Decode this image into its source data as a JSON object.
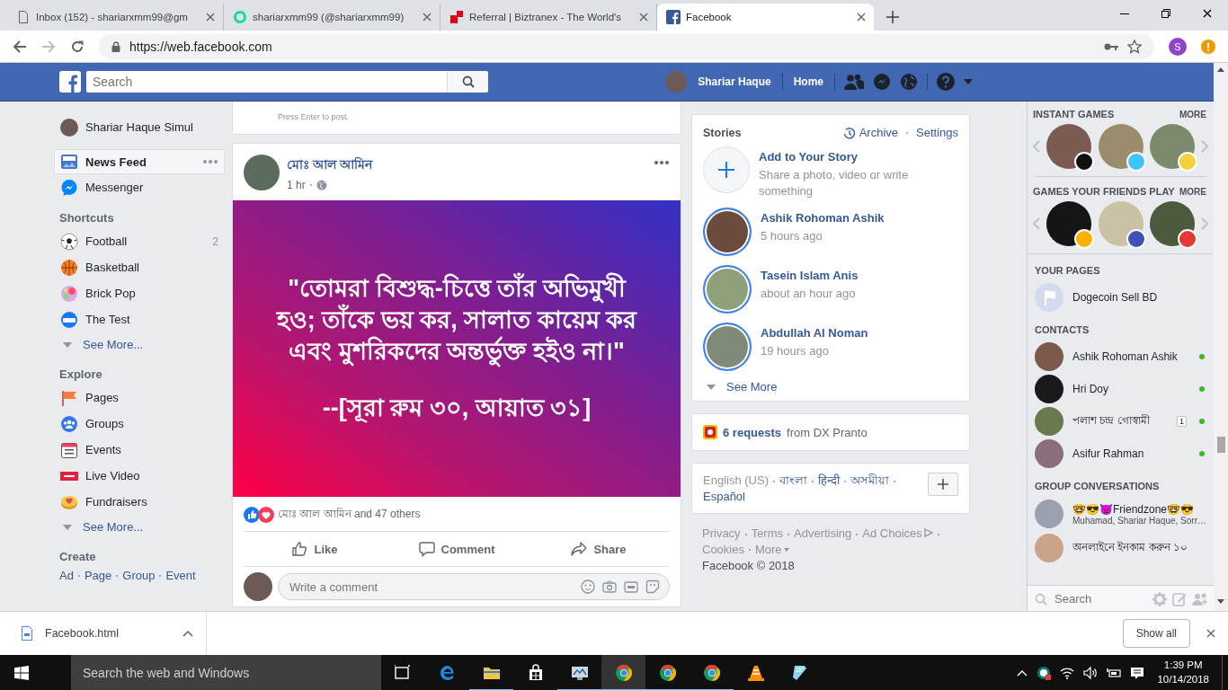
{
  "browser": {
    "tabs": [
      {
        "title": "Inbox (152) - shariarxmm99@gm",
        "selected": false
      },
      {
        "title": "shariarxmm99 (@shariarxmm99)",
        "selected": false
      },
      {
        "title": "Referral | Biztranex - The World's",
        "selected": false
      },
      {
        "title": "Facebook",
        "selected": true
      }
    ],
    "url": "https://web.facebook.com",
    "profile_initial": "S"
  },
  "topbar": {
    "search_placeholder": "Search",
    "user_name": "Shariar Haque",
    "home_link": "Home"
  },
  "left_nav": {
    "profile_name": "Shariar Haque Simul",
    "main_items": [
      {
        "label": "News Feed",
        "selected": true
      },
      {
        "label": "Messenger",
        "selected": false
      }
    ],
    "sections": [
      {
        "title": "Shortcuts",
        "items": [
          {
            "label": "Football",
            "count": "2"
          },
          {
            "label": "Basketball"
          },
          {
            "label": "Brick Pop"
          },
          {
            "label": "The Test"
          }
        ],
        "see_more": "See More..."
      },
      {
        "title": "Explore",
        "items": [
          {
            "label": "Pages"
          },
          {
            "label": "Groups"
          },
          {
            "label": "Events"
          },
          {
            "label": "Live Video"
          },
          {
            "label": "Fundraisers"
          }
        ],
        "see_more": "See More..."
      }
    ],
    "create": {
      "title": "Create",
      "links": [
        "Ad",
        "Page",
        "Group",
        "Event"
      ]
    }
  },
  "feed": {
    "composer_hint": "Press Enter to post.",
    "post": {
      "author": "মোঃ আল আমিন",
      "time": "1 hr",
      "quote": "\"তোমরা বিশুদ্ধ-চিত্তে তাঁর অভিমুখী হও; তাঁকে ভয় কর, সালাত কায়েম কর এবং মুশরিকদের অন্তর্ভুক্ত হইও না।\"",
      "reference": "--[সূরা রুম ৩০, আয়াত ৩১]",
      "reactions": "মোঃ আল আমিন and 47 others",
      "actions": [
        "Like",
        "Comment",
        "Share"
      ],
      "comment_placeholder": "Write a comment"
    }
  },
  "right_column": {
    "stories": {
      "title": "Stories",
      "links": [
        "Archive",
        "Settings"
      ],
      "add_story": {
        "title": "Add to Your Story",
        "subtitle": "Share a photo, video or write something"
      },
      "items": [
        {
          "name": "Ashik Rohoman Ashik",
          "time": "5 hours ago"
        },
        {
          "name": "Tasein Islam Anis",
          "time": "about an hour ago"
        },
        {
          "name": "Abdullah Al Noman",
          "time": "19 hours ago"
        }
      ],
      "see_more": "See More"
    },
    "requests": {
      "link": "6 requests",
      "source": "from DX Pranto"
    },
    "languages": [
      {
        "label": "English (US)",
        "selected": true
      },
      {
        "label": "বাংলা",
        "selected": false
      },
      {
        "label": "हिन्दी",
        "selected": false
      },
      {
        "label": "অসমীয়া",
        "selected": false
      },
      {
        "label": "Español",
        "selected": false
      }
    ],
    "footer_links": [
      "Privacy",
      "Terms",
      "Advertising",
      "Ad Choices",
      "Cookies",
      "More"
    ],
    "copyright": "Facebook © 2018"
  },
  "chat": {
    "instant_games": {
      "title": "INSTANT GAMES",
      "more": "MORE"
    },
    "friends_games": {
      "title": "GAMES YOUR FRIENDS PLAY",
      "more": "MORE"
    },
    "pages": {
      "title": "YOUR PAGES",
      "items": [
        "Dogecoin Sell BD"
      ]
    },
    "contacts": {
      "title": "CONTACTS",
      "items": [
        {
          "name": "Ashik Rohoman Ashik",
          "online": true
        },
        {
          "name": "Hri Doy",
          "online": true
        },
        {
          "name": "পলাশ চন্দ্র গোস্বামী",
          "online": true,
          "unread": "1"
        },
        {
          "name": "Asifur Rahman",
          "online": true
        }
      ]
    },
    "groups": {
      "title": "GROUP CONVERSATIONS",
      "items": [
        {
          "name": "🤓😎👿Friendzone🤓😎",
          "members": "Muhamad, Shariar Haque, Sorr…"
        },
        {
          "name": "অনলাইনে ইনকাম করুন ১০"
        }
      ]
    },
    "search_placeholder": "Search"
  },
  "downloads": {
    "file": "Facebook.html",
    "show_all": "Show all"
  },
  "taskbar": {
    "search_placeholder": "Search the web and Windows",
    "time": "1:39 PM",
    "date": "10/14/2018"
  }
}
